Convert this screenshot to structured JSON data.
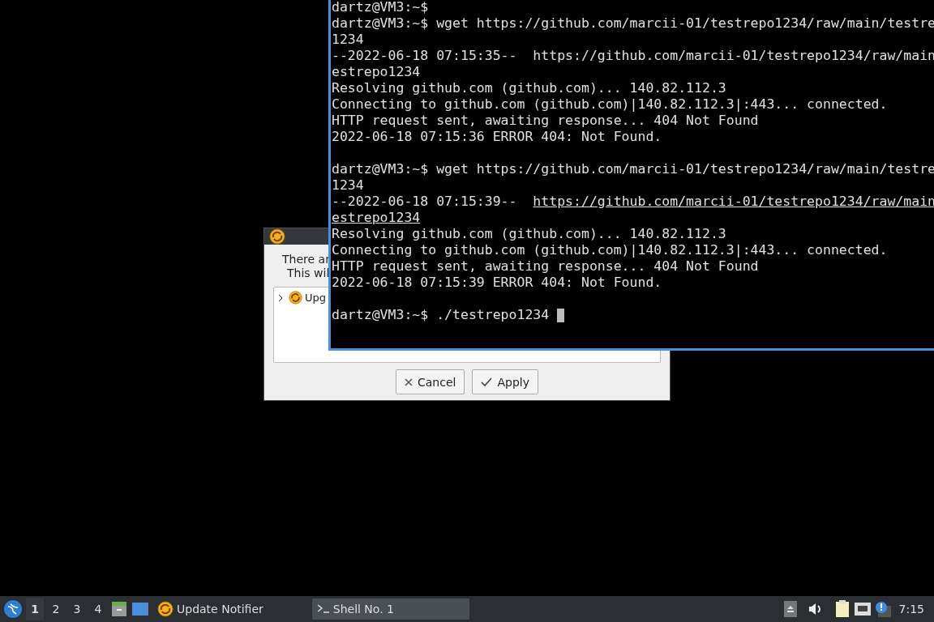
{
  "terminal": {
    "blocks": [
      [
        {
          "text": "dartz@VM3:~$"
        },
        {
          "text": "dartz@VM3:~$ wget https://github.com/marcii-01/testrepo1234/raw/main/testre"
        },
        {
          "text": "1234"
        },
        {
          "text": "--2022-06-18 07:15:35--  https://github.com/marcii-01/testrepo1234/raw/main"
        },
        {
          "text": "estrepo1234"
        },
        {
          "text": "Resolving github.com (github.com)... 140.82.112.3"
        },
        {
          "text": "Connecting to github.com (github.com)|140.82.112.3|:443... connected."
        },
        {
          "text": "HTTP request sent, awaiting response... 404 Not Found"
        },
        {
          "text": "2022-06-18 07:15:36 ERROR 404: Not Found."
        }
      ],
      [
        {
          "text": "dartz@VM3:~$ wget https://github.com/marcii-01/testrepo1234/raw/main/testre"
        },
        {
          "text": "1234"
        },
        {
          "text": "--2022-06-18 07:15:39--  ",
          "link": "https://github.com/marcii-01/testrepo1234/raw/main"
        },
        {
          "link": "estrepo1234"
        },
        {
          "text": "Resolving github.com (github.com)... 140.82.112.3"
        },
        {
          "text": "Connecting to github.com (github.com)|140.82.112.3|:443... connected."
        },
        {
          "text": "HTTP request sent, awaiting response... 404 Not Found"
        },
        {
          "text": "2022-06-18 07:15:39 ERROR 404: Not Found."
        }
      ],
      [
        {
          "text": "dartz@VM3:~$ ./testrepo1234 ",
          "cursor": true
        }
      ]
    ]
  },
  "dialog": {
    "message_lines": [
      "There ar",
      "This wil"
    ],
    "tree_items": [
      {
        "label": "Upg",
        "expanded": false
      }
    ],
    "buttons": [
      {
        "kind": "cancel",
        "label": "Cancel"
      },
      {
        "kind": "apply",
        "label": "Apply"
      }
    ]
  },
  "taskbar": {
    "workspaces": [
      {
        "label": "1",
        "selected": true
      },
      {
        "label": "2",
        "selected": false
      },
      {
        "label": "3",
        "selected": false
      },
      {
        "label": "4",
        "selected": false
      }
    ],
    "tasks": [
      {
        "kind": "updater",
        "label": "Update Notifier",
        "selected": false
      },
      {
        "kind": "shell",
        "label": "Shell No. 1",
        "selected": true
      }
    ],
    "clock": "7:15"
  }
}
